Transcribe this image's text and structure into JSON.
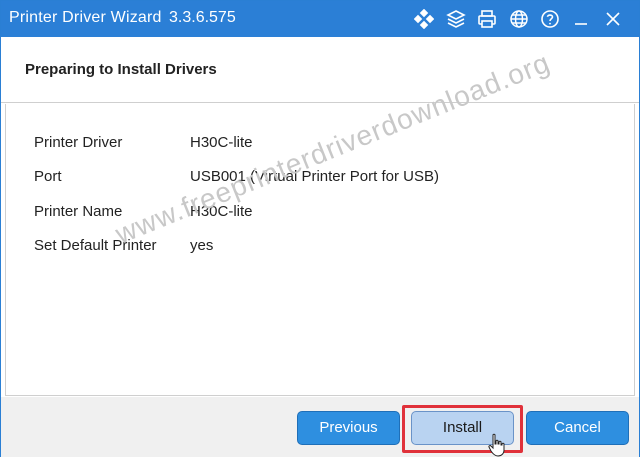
{
  "window": {
    "title": "Printer Driver Wizard",
    "version": "3.3.6.575"
  },
  "titlebar_icons": [
    {
      "name": "apps-diamond-icon"
    },
    {
      "name": "layers-icon"
    },
    {
      "name": "printer-icon"
    },
    {
      "name": "globe-icon"
    },
    {
      "name": "help-icon"
    },
    {
      "name": "minimize-icon"
    },
    {
      "name": "close-icon"
    }
  ],
  "header": {
    "title": "Preparing to Install Drivers"
  },
  "details": [
    {
      "label": "Printer Driver",
      "value": "H30C-lite"
    },
    {
      "label": "Port",
      "value": "USB001 (Virtual Printer Port for USB)"
    },
    {
      "label": "Printer Name",
      "value": "H30C-lite"
    },
    {
      "label": "Set Default Printer",
      "value": "yes"
    }
  ],
  "watermark": "www.freeprinterdriverdownload.org",
  "buttons": {
    "previous": "Previous",
    "install": "Install",
    "cancel": "Cancel"
  },
  "colors": {
    "titlebar": "#2b7fd6",
    "button": "#2e8fe0",
    "install_active": "#b9d3f1",
    "highlight": "#e0313a"
  }
}
